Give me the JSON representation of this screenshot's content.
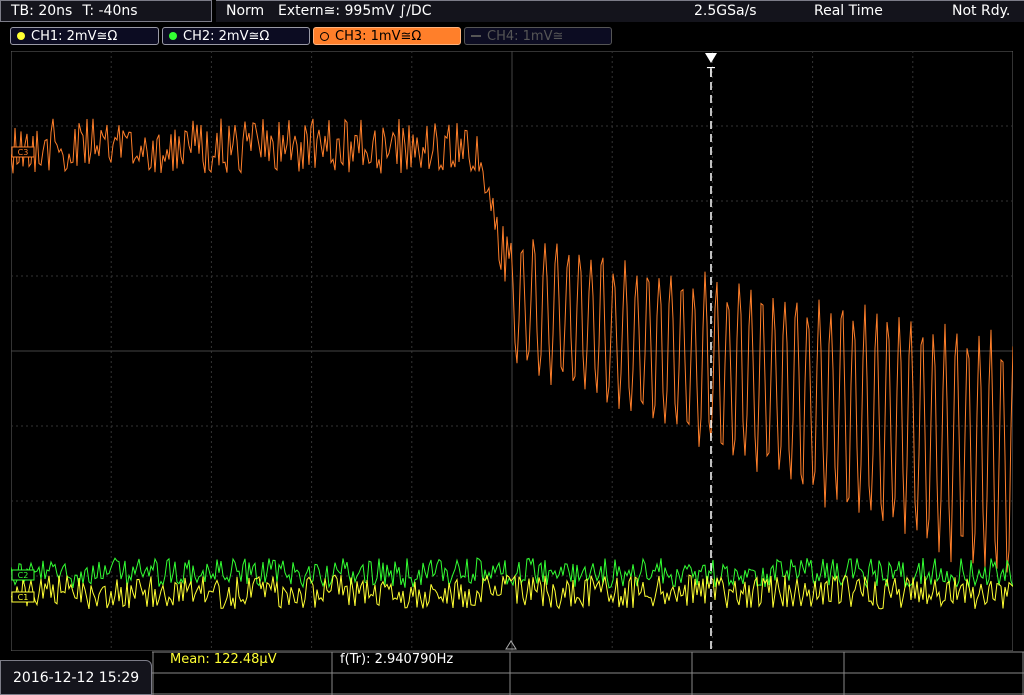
{
  "header": {
    "timebase": "TB: 20ns",
    "trigger_time": "T: -40ns",
    "mode": "Norm",
    "trigger_source": "Extern≅: 995mV ∫/DC",
    "sample_rate": "2.5GSa/s",
    "acq_mode": "Real Time",
    "status": "Not Rdy."
  },
  "channels": [
    {
      "label": "CH1: 2mV≅Ω",
      "color": "#ffff33",
      "state": "on"
    },
    {
      "label": "CH2: 2mV≅Ω",
      "color": "#33ff33",
      "state": "on"
    },
    {
      "label": "CH3: 1mV≅Ω",
      "color": "#ff7f2a",
      "state": "active"
    },
    {
      "label": "CH4: 1mV≅",
      "color": "#555555",
      "state": "off"
    }
  ],
  "markers": {
    "ch3_ref": "C3",
    "ch2_ref": "C2",
    "ch1_ref": "C1",
    "trigger_marker": "T"
  },
  "measurements": {
    "mean": "Mean: 122.48µV",
    "frequency": "f(Tr): 2.940790Hz"
  },
  "datetime": "2016-12-12 15:29",
  "colors": {
    "ch1": "#ffff33",
    "ch2": "#33ff33",
    "ch3": "#ff7f2a",
    "grid": "#555555",
    "cursor": "#ffffff"
  }
}
